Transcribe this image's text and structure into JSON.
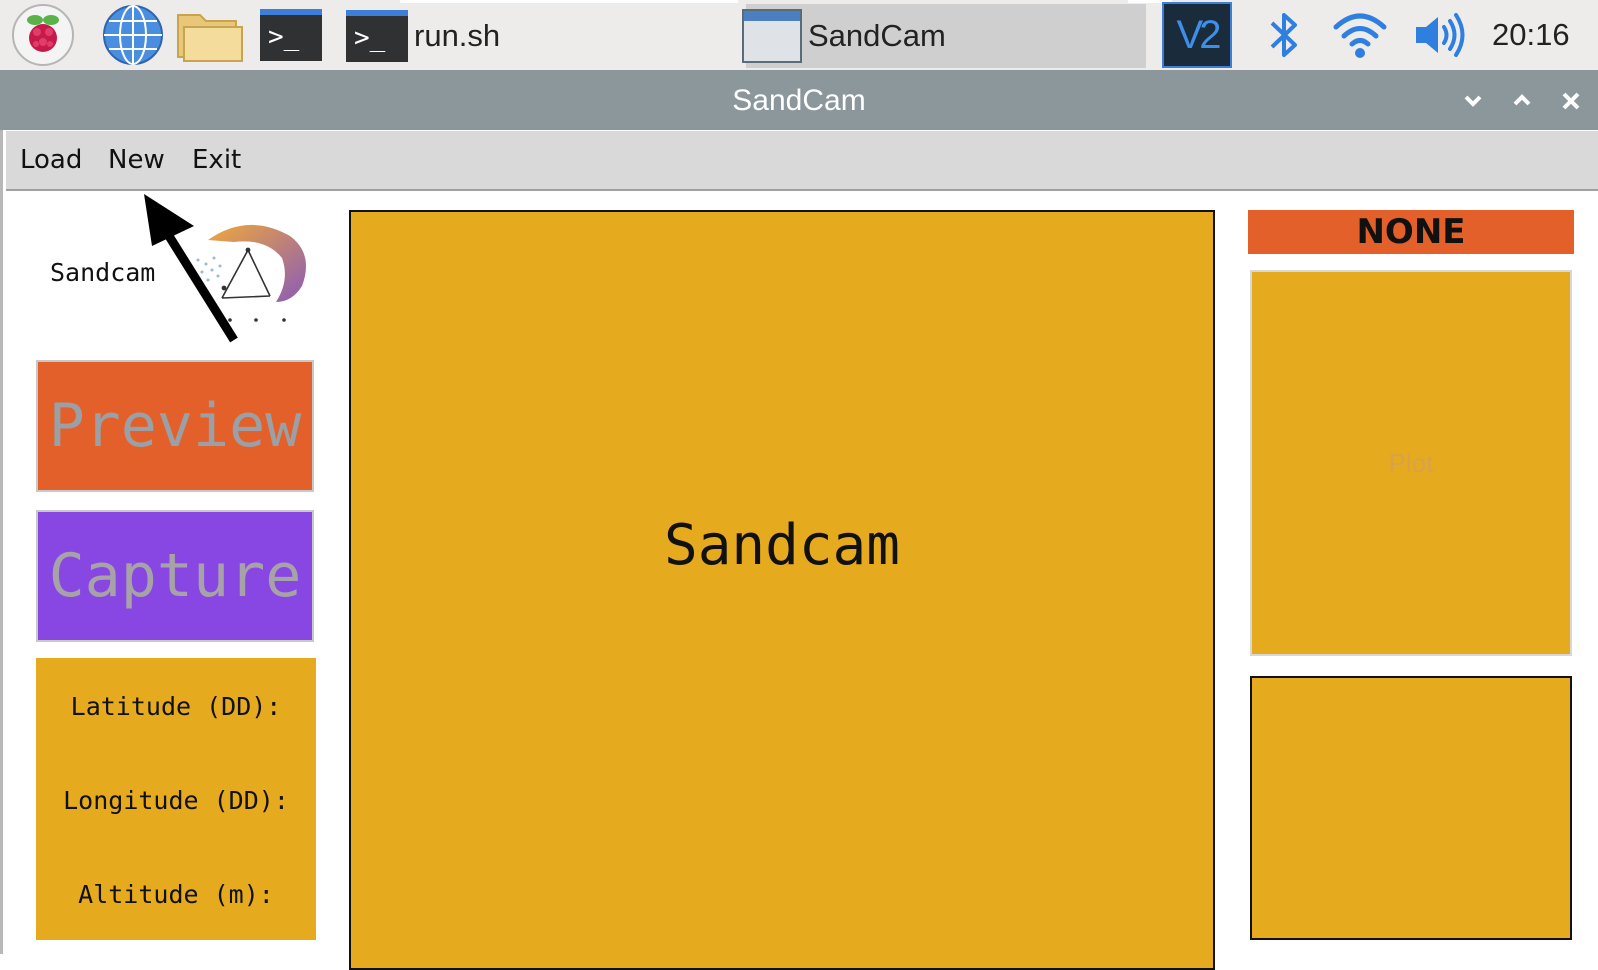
{
  "taskbar": {
    "tasks": [
      {
        "label": "run.sh"
      },
      {
        "label": "SandCam"
      }
    ],
    "vnc_label": "V2",
    "clock": "20:16",
    "icons": [
      "raspberry-pi-icon",
      "globe-icon",
      "folder-icon",
      "terminal-icon",
      "bluetooth-icon",
      "wifi-icon",
      "volume-icon"
    ]
  },
  "window": {
    "title": "SandCam",
    "controls": [
      "minimize-icon",
      "maximize-icon",
      "close-icon"
    ]
  },
  "menubar": {
    "items": [
      {
        "label": "Load"
      },
      {
        "label": "New"
      },
      {
        "label": "Exit"
      }
    ]
  },
  "sidebar": {
    "logo_text": "Sandcam",
    "preview_label": "Preview",
    "capture_label": "Capture",
    "latitude_label": "Latitude (DD):",
    "longitude_label": "Longitude (DD):",
    "altitude_label": "Altitude (m):"
  },
  "main": {
    "view_label": "Sandcam"
  },
  "right": {
    "status": "NONE",
    "plot_label": "Plot"
  },
  "colors": {
    "accent_orange": "#e4602a",
    "accent_purple": "#8847e3",
    "panel_gold": "#e6aa1e",
    "titlebar_gray": "#8c979c"
  }
}
